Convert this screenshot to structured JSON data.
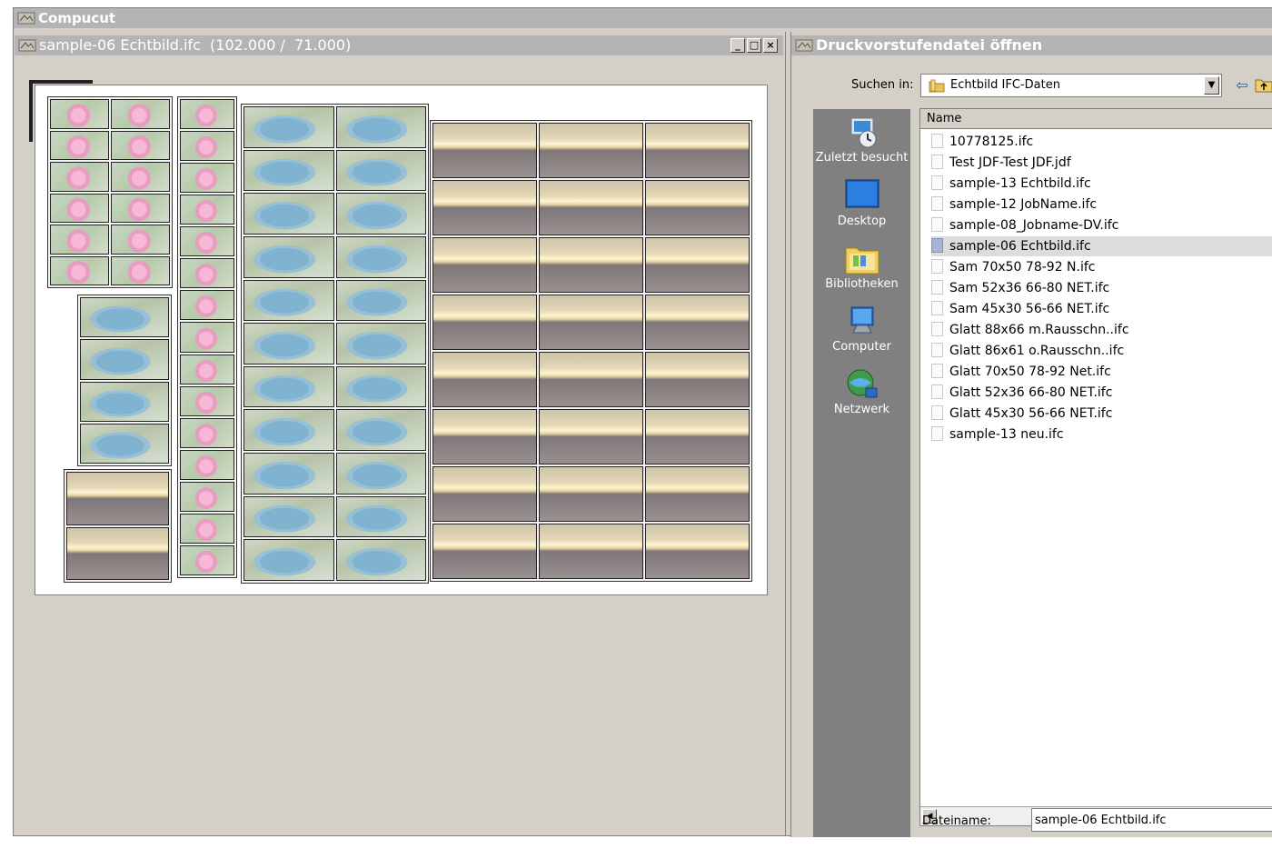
{
  "app": {
    "title": "Compucut"
  },
  "child_window": {
    "title": "sample-06 Echtbild.ifc  (102.000 /  71.000)",
    "buttons": {
      "minimize": "_",
      "restore": "□",
      "close": "×"
    }
  },
  "dialog": {
    "title": "Druckvorstufendatei öffnen",
    "look_in_label": "Suchen in:",
    "look_in_value": "Echtbild IFC-Daten",
    "places": [
      {
        "label": "Zuletzt besucht",
        "icon": "recent-places-icon"
      },
      {
        "label": "Desktop",
        "icon": "desktop-icon"
      },
      {
        "label": "Bibliotheken",
        "icon": "libraries-icon"
      },
      {
        "label": "Computer",
        "icon": "computer-icon"
      },
      {
        "label": "Netzwerk",
        "icon": "network-icon"
      }
    ],
    "column_header": "Name",
    "files": [
      "10778125.ifc",
      "Test JDF-Test JDF.jdf",
      "sample-13 Echtbild.ifc",
      "sample-12 JobName.ifc",
      "sample-08_Jobname-DV.ifc",
      "sample-06 Echtbild.ifc",
      "Sam 70x50 78-92 N.ifc",
      "Sam 52x36 66-80 NET.ifc",
      "Sam 45x30 56-66 NET.ifc",
      "Glatt 88x66 m.Rausschn..ifc",
      "Glatt 86x61 o.Rausschn..ifc",
      "Glatt 70x50 78-92 Net.ifc",
      "Glatt 52x36 66-80 NET.ifc",
      "Glatt 45x30 56-66 NET.ifc",
      "sample-13 neu.ifc"
    ],
    "selected_file": "sample-06 Echtbild.ifc",
    "filename_label": "Dateiname:",
    "filename_value": "sample-06 Echtbild.ifc"
  }
}
